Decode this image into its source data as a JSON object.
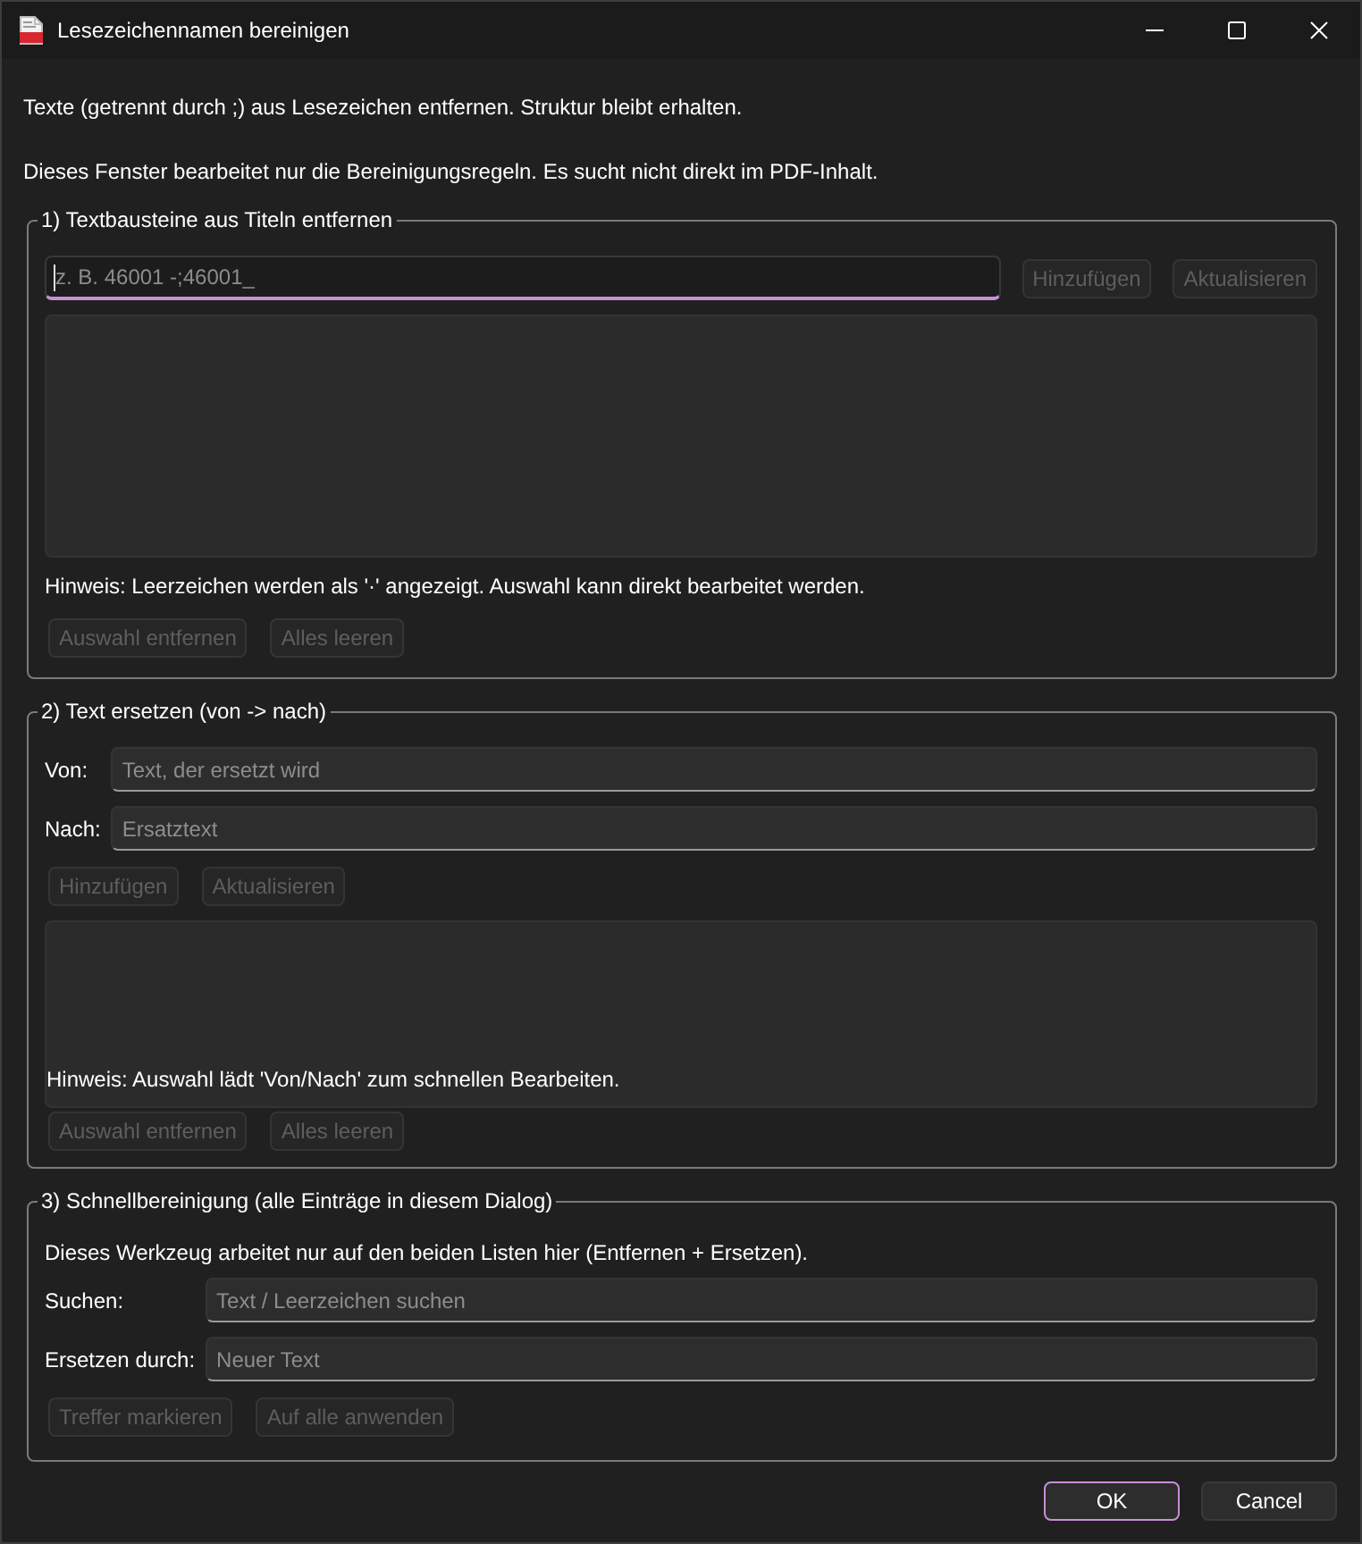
{
  "window": {
    "title": "Lesezeichennamen bereinigen"
  },
  "intro": [
    "Texte (getrennt durch ;) aus Lesezeichen entfernen. Struktur bleibt erhalten.",
    "Dieses Fenster bearbeitet nur die Bereinigungsregeln. Es sucht nicht direkt im PDF-Inhalt."
  ],
  "sections": [
    {
      "title": "1) Textbausteine aus Titeln entfernen",
      "rows": [
        {
          "kind": "input-buttons",
          "field": {
            "placeholder": "z. B. 46001 -;46001_",
            "focused": true
          },
          "buttons": [
            {
              "label": "Hinzufügen",
              "disabled": true
            },
            {
              "label": "Aktualisieren",
              "disabled": true
            }
          ]
        },
        {
          "kind": "list"
        },
        {
          "kind": "note",
          "text": "Hinweis: Leerzeichen werden als '·' angezeigt. Auswahl kann direkt bearbeitet werden."
        },
        {
          "kind": "buttons",
          "buttons": [
            {
              "label": "Auswahl entfernen",
              "disabled": true
            },
            {
              "label": "Alles leeren",
              "disabled": true
            }
          ]
        }
      ]
    },
    {
      "title": "2) Text ersetzen (von -> nach)",
      "rows": [
        {
          "kind": "labeled-field",
          "label": "Von:",
          "field": {
            "placeholder": "Text, der ersetzt wird",
            "focused": false
          }
        },
        {
          "kind": "labeled-field",
          "label": "Nach:",
          "field": {
            "placeholder": "Ersatztext",
            "focused": false
          }
        },
        {
          "kind": "buttons",
          "buttons": [
            {
              "label": "Hinzufügen",
              "disabled": true
            },
            {
              "label": "Aktualisieren",
              "disabled": true
            }
          ]
        },
        {
          "kind": "list",
          "note": "Hinweis: Auswahl lädt 'Von/Nach' zum schnellen Bearbeiten."
        },
        {
          "kind": "buttons",
          "buttons": [
            {
              "label": "Auswahl entfernen",
              "disabled": true
            },
            {
              "label": "Alles leeren",
              "disabled": true
            }
          ]
        }
      ]
    },
    {
      "title": "3) Schnellbereinigung (alle Einträge in diesem Dialog)",
      "rows": [
        {
          "kind": "note",
          "text": "Dieses Werkzeug arbeitet nur auf den beiden Listen hier (Entfernen + Ersetzen)."
        },
        {
          "kind": "labeled-field",
          "label": "Suchen:",
          "field": {
            "placeholder": "Text / Leerzeichen suchen",
            "focused": false
          }
        },
        {
          "kind": "labeled-field",
          "label": "Ersetzen durch:",
          "field": {
            "placeholder": "Neuer Text",
            "focused": false
          }
        },
        {
          "kind": "buttons",
          "buttons": [
            {
              "label": "Treffer markieren",
              "disabled": true
            },
            {
              "label": "Auf alle anwenden",
              "disabled": true
            }
          ]
        }
      ]
    }
  ],
  "footer_buttons": [
    {
      "label": "OK",
      "default": true
    },
    {
      "label": "Cancel",
      "default": false
    }
  ]
}
